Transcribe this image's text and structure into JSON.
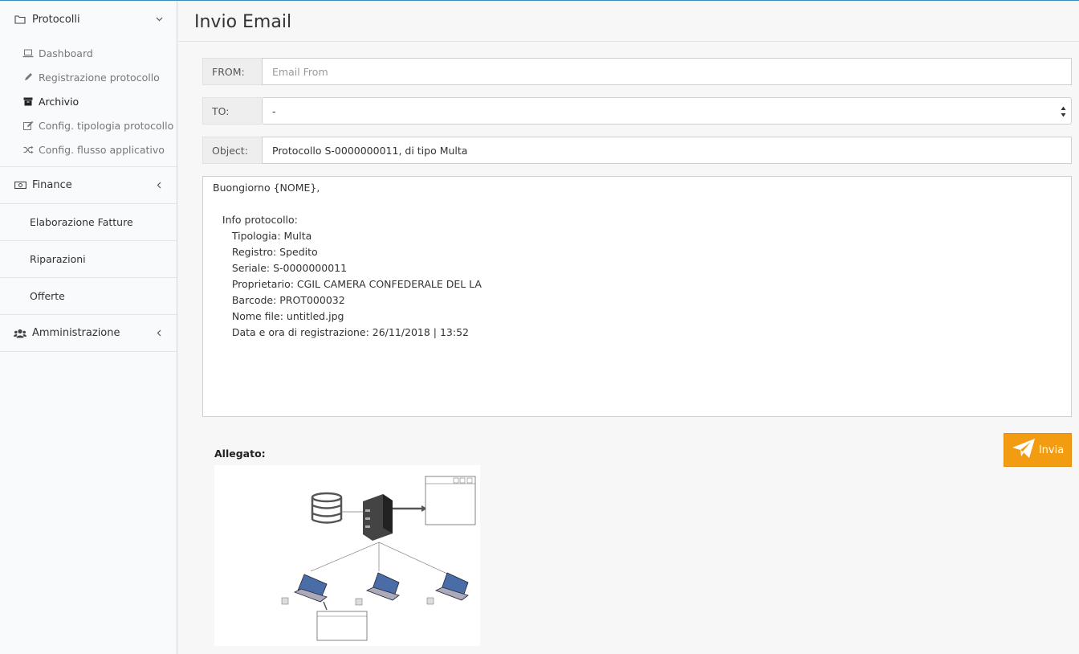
{
  "sidebar": {
    "groups": [
      {
        "label": "Protocolli",
        "icon": "folder-icon",
        "expanded": true
      },
      {
        "label": "Finance",
        "icon": "money-icon",
        "expanded": false
      },
      {
        "label": "Amministrazione",
        "icon": "users-icon",
        "expanded": false
      }
    ],
    "protocolli_items": [
      {
        "label": "Dashboard",
        "icon": "laptop-icon"
      },
      {
        "label": "Registrazione protocollo",
        "icon": "pencil-icon"
      },
      {
        "label": "Archivio",
        "icon": "archive-icon",
        "active": true
      },
      {
        "label": "Config. tipologia protocollo",
        "icon": "edit-icon"
      },
      {
        "label": "Config. flusso applicativo",
        "icon": "shuffle-icon"
      }
    ],
    "plain_items": [
      "Elaborazione Fatture",
      "Riparazioni",
      "Offerte"
    ]
  },
  "page": {
    "title": "Invio Email"
  },
  "form": {
    "from_label": "FROM:",
    "from_placeholder": "Email From",
    "to_label": "TO:",
    "to_value": "-",
    "object_label": "Object:",
    "object_value": "Protocollo S-0000000011, di tipo Multa",
    "body_lines": [
      "Buongiorno {NOME},",
      "",
      "   Info protocollo:",
      "      Tipologia: Multa",
      "      Registro: Spedito",
      "      Seriale: S-0000000011",
      "      Proprietario: CGIL CAMERA CONFEDERALE DEL LA",
      "      Barcode: PROT000032",
      "      Nome file: untitled.jpg",
      "      Data e ora di registrazione: 26/11/2018 | 13:52"
    ]
  },
  "attachment": {
    "label": "Allegato:"
  },
  "send_button": {
    "label": "Invia",
    "icon": "paper-plane-icon"
  },
  "colors": {
    "accent": "#f39c12",
    "topline": "#3c8dbc"
  }
}
